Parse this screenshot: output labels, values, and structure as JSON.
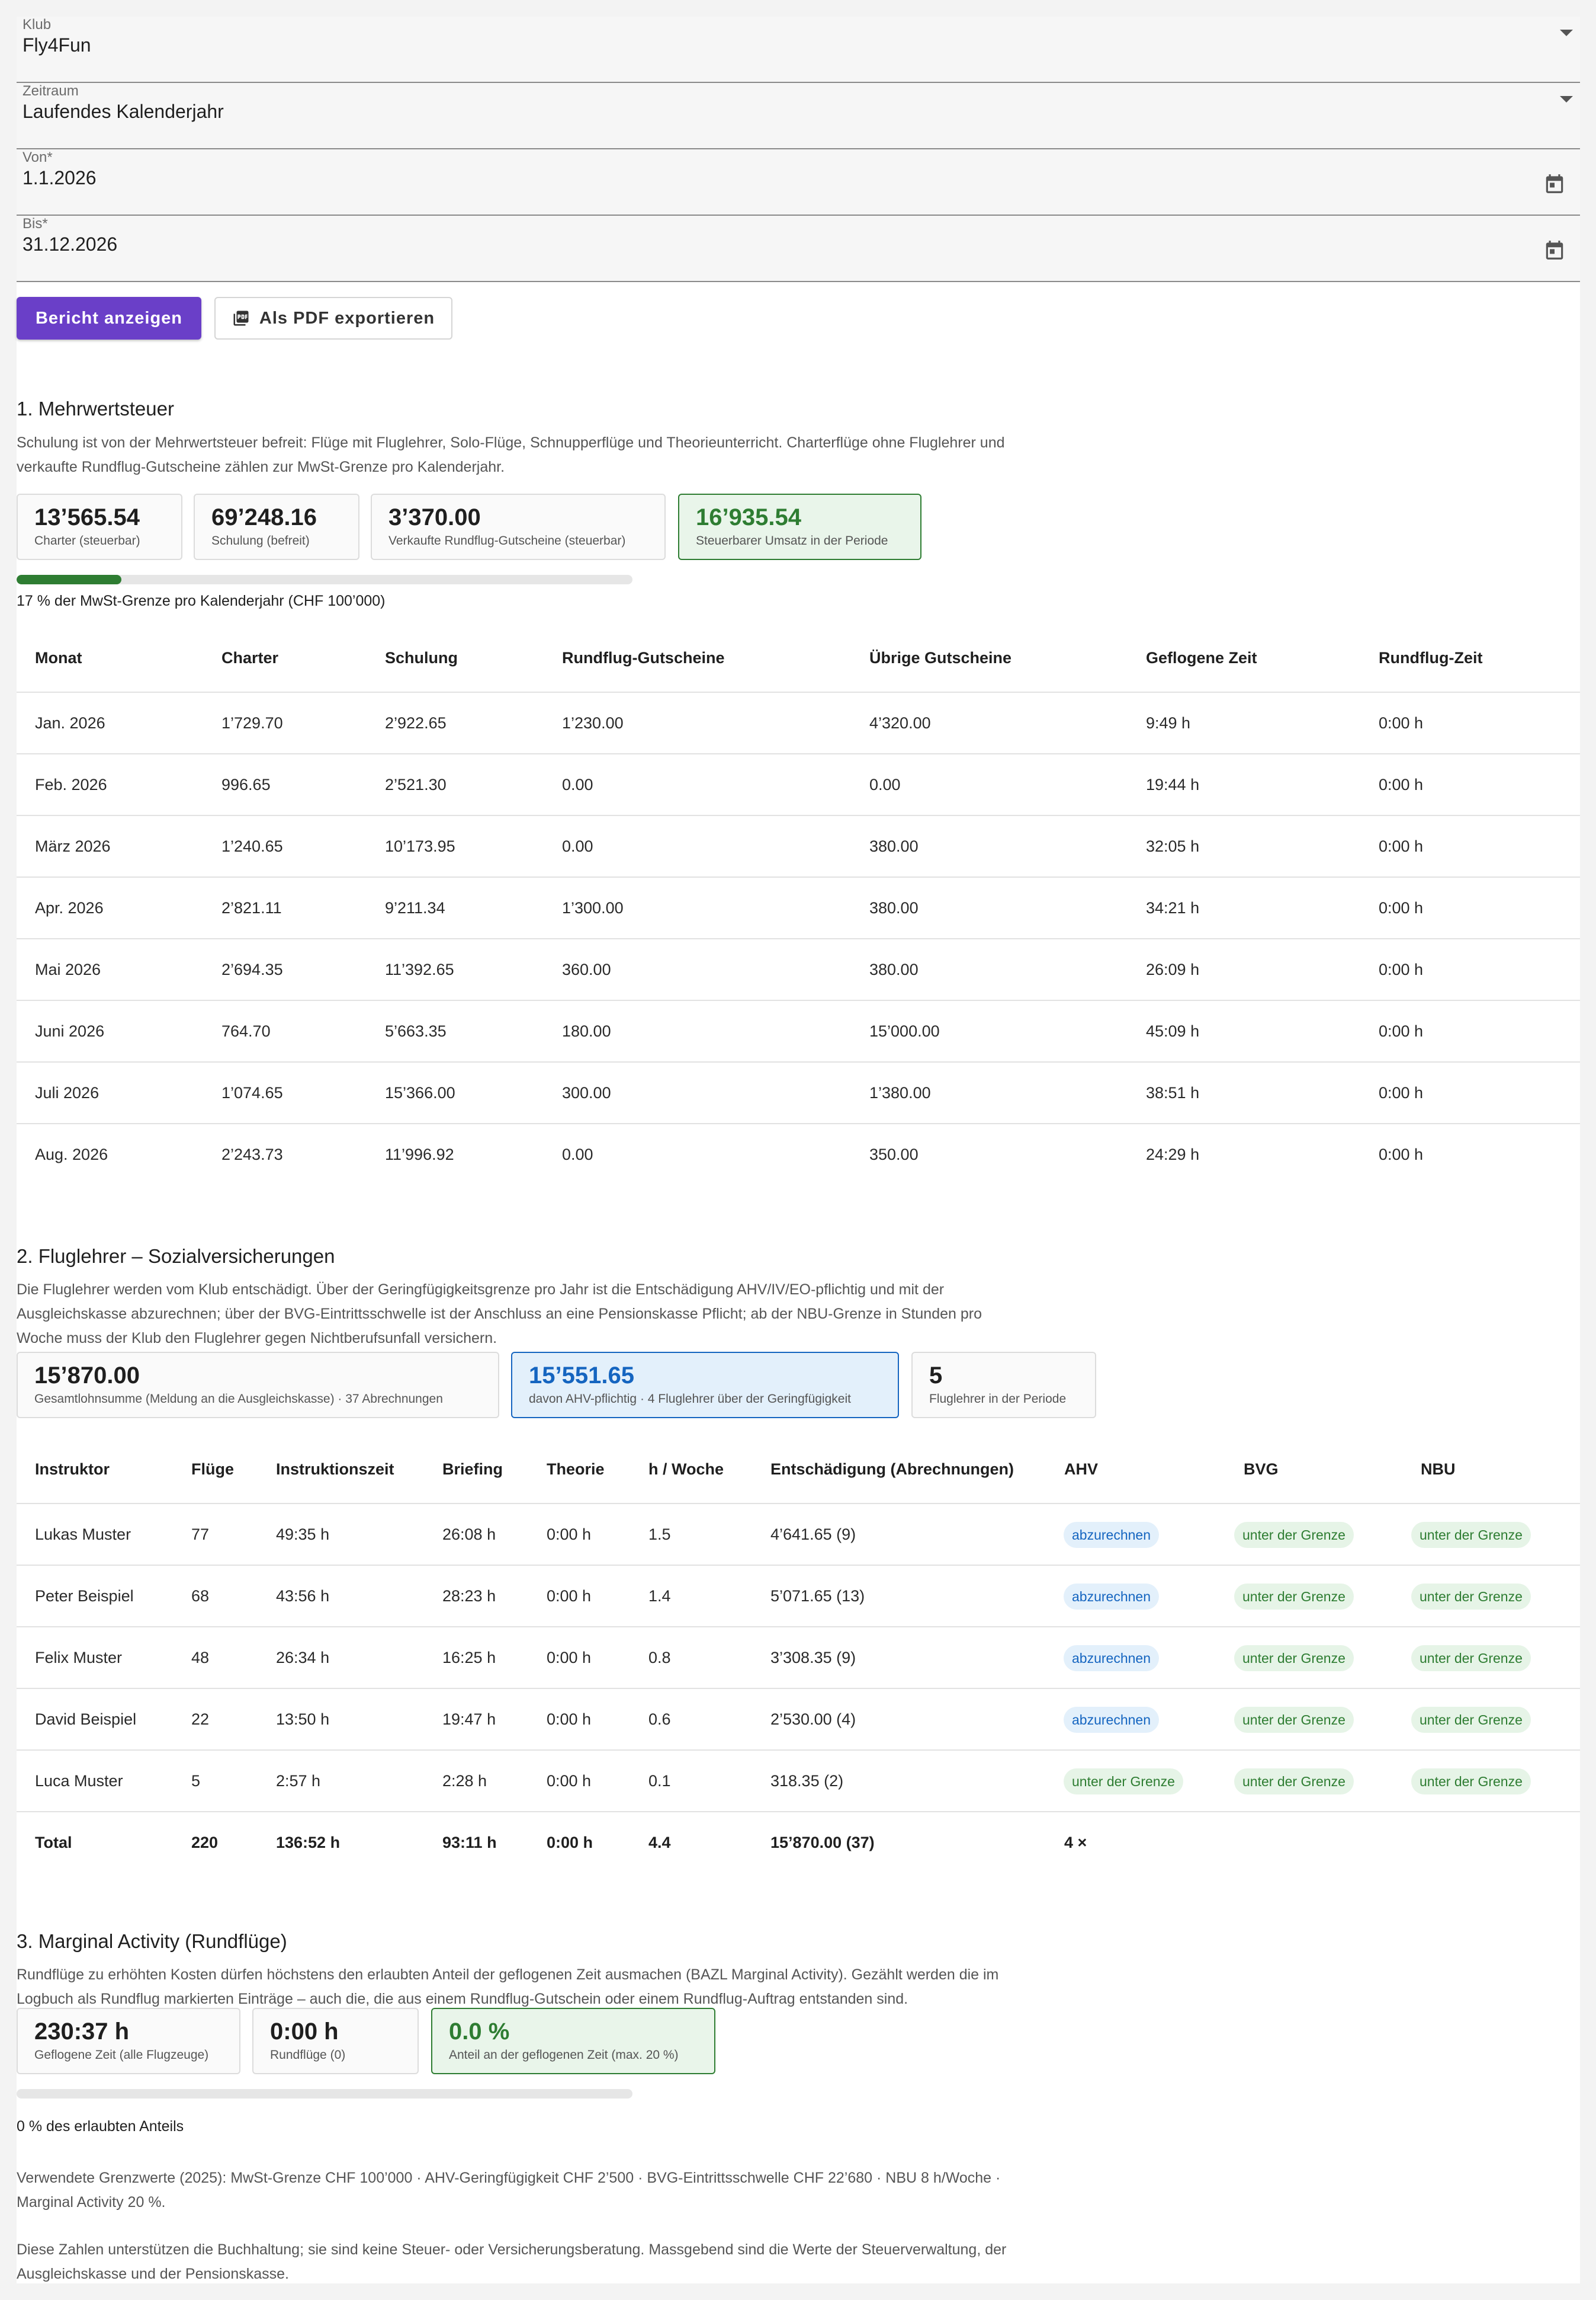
{
  "filters": {
    "klub": {
      "label": "Klub",
      "value": "Fly4Fun"
    },
    "zeitraum": {
      "label": "Zeitraum",
      "value": "Laufendes Kalenderjahr"
    },
    "von": {
      "label": "Von*",
      "value": "1.1.2026"
    },
    "bis": {
      "label": "Bis*",
      "value": "31.12.2026"
    }
  },
  "actions": {
    "show_report": "Bericht anzeigen",
    "export_pdf": "Als PDF exportieren"
  },
  "vat": {
    "title": "1. Mehrwertsteuer",
    "desc_line1": "Schulung ist von der Mehrwertsteuer befreit: Flüge mit Fluglehrer, Solo-Flüge, Schnupperflüge und Theorieunterricht. Charterflüge ohne Fluglehrer und",
    "desc_line2": "verkaufte Rundflug-Gutscheine zählen zur MwSt-Grenze pro Kalenderjahr.",
    "stats": [
      {
        "value": "13’565.54",
        "label": "Charter (steuerbar)"
      },
      {
        "value": "69’248.16",
        "label": "Schulung (befreit)"
      },
      {
        "value": "3’370.00",
        "label": "Verkaufte Rundflug-Gutscheine (steuerbar)"
      },
      {
        "value": "16’935.54",
        "label": "Steuerbarer Umsatz in der Periode"
      }
    ],
    "progress_fraction": 0.17,
    "progress_text": "17 % der MwSt-Grenze pro Kalenderjahr (CHF 100’000)",
    "columns": [
      "Monat",
      "Charter",
      "Schulung",
      "Rundflug-Gutscheine",
      "Übrige Gutscheine",
      "Geflogene Zeit",
      "Rundflug-Zeit"
    ],
    "rows": [
      [
        "Jan. 2026",
        "1’729.70",
        "2’922.65",
        "1’230.00",
        "4’320.00",
        "9:49 h",
        "0:00 h"
      ],
      [
        "Feb. 2026",
        "996.65",
        "2’521.30",
        "0.00",
        "0.00",
        "19:44 h",
        "0:00 h"
      ],
      [
        "März 2026",
        "1’240.65",
        "10’173.95",
        "0.00",
        "380.00",
        "32:05 h",
        "0:00 h"
      ],
      [
        "Apr. 2026",
        "2’821.11",
        "9’211.34",
        "1’300.00",
        "380.00",
        "34:21 h",
        "0:00 h"
      ],
      [
        "Mai 2026",
        "2’694.35",
        "11’392.65",
        "360.00",
        "380.00",
        "26:09 h",
        "0:00 h"
      ],
      [
        "Juni 2026",
        "764.70",
        "5’663.35",
        "180.00",
        "15’000.00",
        "45:09 h",
        "0:00 h"
      ],
      [
        "Juli 2026",
        "1’074.65",
        "15’366.00",
        "300.00",
        "1’380.00",
        "38:51 h",
        "0:00 h"
      ],
      [
        "Aug. 2026",
        "2’243.73",
        "11’996.92",
        "0.00",
        "350.00",
        "24:29 h",
        "0:00 h"
      ]
    ]
  },
  "instructors": {
    "title": "2. Fluglehrer – Sozialversicherungen",
    "desc_line1": "Die Fluglehrer werden vom Klub entschädigt. Über der Geringfügigkeitsgrenze pro Jahr ist die Entschädigung AHV/IV/EO-pflichtig und mit der",
    "desc_line2": "Ausgleichskasse abzurechnen; über der BVG-Eintrittsschwelle ist der Anschluss an eine Pensionskasse Pflicht; ab der NBU-Grenze in Stunden pro",
    "desc_line3": "Woche muss der Klub den Fluglehrer gegen Nichtberufsunfall versichern.",
    "stats": [
      {
        "value": "15’870.00",
        "label": "Gesamtlohnsumme (Meldung an die Ausgleichskasse) · 37 Abrechnungen"
      },
      {
        "value": "15’551.65",
        "label": "davon AHV-pflichtig · 4 Fluglehrer über der Geringfügigkeit"
      },
      {
        "value": "5",
        "label": "Fluglehrer in der Periode"
      }
    ],
    "columns": [
      "Instruktor",
      "Flüge",
      "Instruktionszeit",
      "Briefing",
      "Theorie",
      "h / Woche",
      "Entschädigung (Abrechnungen)",
      "AHV",
      "BVG",
      "NBU"
    ],
    "rows": [
      {
        "name": "Lukas Muster",
        "flights": "77",
        "instr": "49:35 h",
        "brief": "26:08 h",
        "theory": "0:00 h",
        "hw": "1.5",
        "comp": "4’641.65 (9)",
        "ahv": "abzurechnen",
        "ahv_style": "blue",
        "bvg": "unter der Grenze",
        "nbu": "unter der Grenze"
      },
      {
        "name": "Peter Beispiel",
        "flights": "68",
        "instr": "43:56 h",
        "brief": "28:23 h",
        "theory": "0:00 h",
        "hw": "1.4",
        "comp": "5’071.65 (13)",
        "ahv": "abzurechnen",
        "ahv_style": "blue",
        "bvg": "unter der Grenze",
        "nbu": "unter der Grenze"
      },
      {
        "name": "Felix Muster",
        "flights": "48",
        "instr": "26:34 h",
        "brief": "16:25 h",
        "theory": "0:00 h",
        "hw": "0.8",
        "comp": "3’308.35 (9)",
        "ahv": "abzurechnen",
        "ahv_style": "blue",
        "bvg": "unter der Grenze",
        "nbu": "unter der Grenze"
      },
      {
        "name": "David Beispiel",
        "flights": "22",
        "instr": "13:50 h",
        "brief": "19:47 h",
        "theory": "0:00 h",
        "hw": "0.6",
        "comp": "2’530.00 (4)",
        "ahv": "abzurechnen",
        "ahv_style": "blue",
        "bvg": "unter der Grenze",
        "nbu": "unter der Grenze"
      },
      {
        "name": "Luca Muster",
        "flights": "5",
        "instr": "2:57 h",
        "brief": "2:28 h",
        "theory": "0:00 h",
        "hw": "0.1",
        "comp": "318.35 (2)",
        "ahv": "unter der Grenze",
        "ahv_style": "green",
        "bvg": "unter der Grenze",
        "nbu": "unter der Grenze"
      }
    ],
    "total": {
      "name": "Total",
      "flights": "220",
      "instr": "136:52 h",
      "brief": "93:11 h",
      "theory": "0:00 h",
      "hw": "4.4",
      "comp": "15’870.00 (37)",
      "ahv": "4 ×"
    }
  },
  "marginal": {
    "title": "3. Marginal Activity (Rundflüge)",
    "desc_line1": "Rundflüge zu erhöhten Kosten dürfen höchstens den erlaubten Anteil der geflogenen Zeit ausmachen (BAZL Marginal Activity). Gezählt werden die im",
    "desc_line2": "Logbuch als Rundflug markierten Einträge – auch die, die aus einem Rundflug-Gutschein oder einem Rundflug-Auftrag entstanden sind.",
    "stats": [
      {
        "value": "230:37 h",
        "label": "Geflogene Zeit (alle Flugzeuge)"
      },
      {
        "value": "0:00 h",
        "label": "Rundflüge (0)"
      },
      {
        "value": "0.0 %",
        "label": "Anteil an der geflogenen Zeit (max. 20 %)"
      }
    ],
    "progress_fraction": 0.0,
    "progress_text": "0 % des erlaubten Anteils"
  },
  "footer": {
    "limits_line1": "Verwendete Grenzwerte (2025): MwSt-Grenze CHF 100’000 · AHV-Geringfügigkeit CHF 2’500 · BVG-Eintrittsschwelle CHF 22’680 · NBU 8 h/Woche ·",
    "limits_line2": "Marginal Activity 20 %.",
    "disclaimer_line1": "Diese Zahlen unterstützen die Buchhaltung; sie sind keine Steuer- oder Versicherungsberatung. Massgebend sind die Werte der Steuerverwaltung, der",
    "disclaimer_line2": "Ausgleichskasse und der Pensionskasse."
  },
  "colors": {
    "primary": "#6a3fc8",
    "success": "#2e7d32",
    "info": "#1565c0"
  }
}
